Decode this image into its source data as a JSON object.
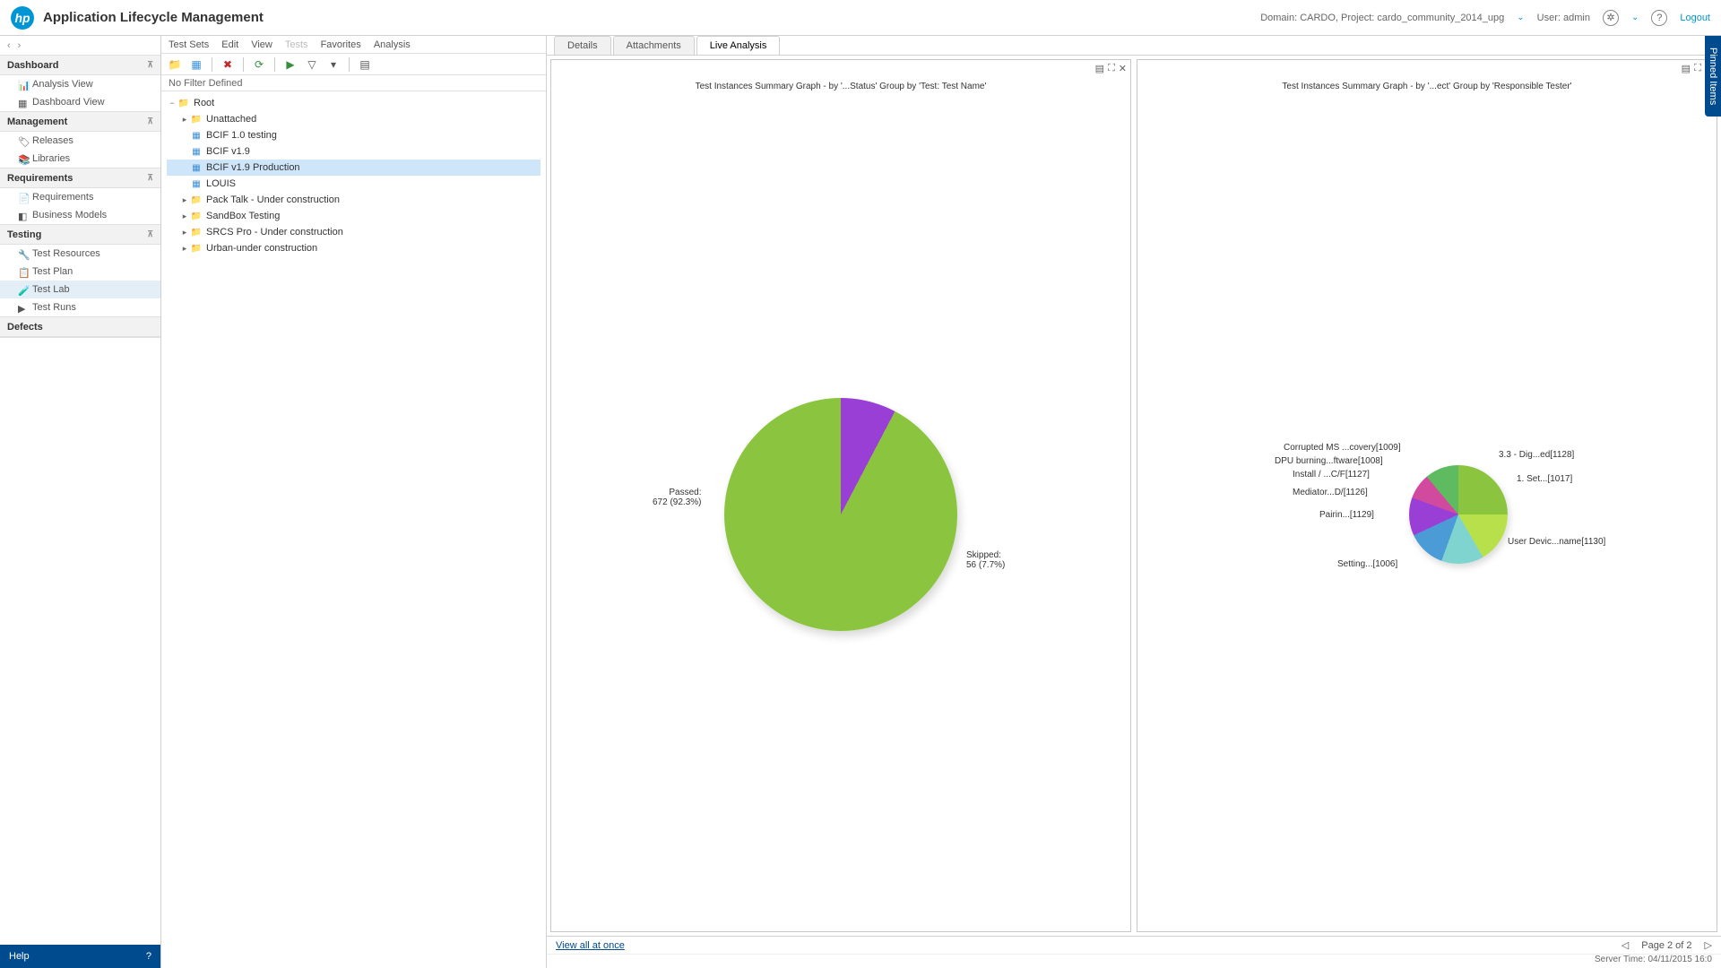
{
  "header": {
    "app_title": "Application Lifecycle Management",
    "domain_project": "Domain: CARDO, Project: cardo_community_2014_upg",
    "user": "User: admin",
    "logout": "Logout"
  },
  "sidebar": {
    "sections": [
      {
        "title": "Dashboard",
        "items": [
          "Analysis View",
          "Dashboard View"
        ]
      },
      {
        "title": "Management",
        "items": [
          "Releases",
          "Libraries"
        ]
      },
      {
        "title": "Requirements",
        "items": [
          "Requirements",
          "Business Models"
        ]
      },
      {
        "title": "Testing",
        "items": [
          "Test Resources",
          "Test Plan",
          "Test Lab",
          "Test Runs"
        ],
        "selected": 2
      },
      {
        "title": "Defects",
        "items": []
      }
    ],
    "help": "Help"
  },
  "menubar": [
    "Test Sets",
    "Edit",
    "View",
    "Tests",
    "Favorites",
    "Analysis"
  ],
  "filter_text": "No Filter Defined",
  "tree": {
    "root": "Root",
    "nodes": [
      {
        "label": "Unattached",
        "type": "folder"
      },
      {
        "label": "BCIF 1.0 testing",
        "type": "file"
      },
      {
        "label": "BCIF v1.9",
        "type": "file"
      },
      {
        "label": "BCIF v1.9 Production",
        "type": "file",
        "selected": true
      },
      {
        "label": "LOUIS",
        "type": "file"
      },
      {
        "label": "Pack Talk - Under construction",
        "type": "folder"
      },
      {
        "label": "SandBox Testing",
        "type": "folder"
      },
      {
        "label": "SRCS Pro - Under construction",
        "type": "folder"
      },
      {
        "label": "Urban-under construction",
        "type": "folder"
      }
    ]
  },
  "tabs": [
    "Details",
    "Attachments",
    "Live Analysis"
  ],
  "active_tab": 2,
  "pinned_label": "Pinned Items",
  "chart_data": [
    {
      "type": "pie",
      "title": "Test Instances Summary Graph - by '...Status' Group by 'Test: Test Name'",
      "series": [
        {
          "name": "Passed",
          "value": 672,
          "pct": 92.3,
          "color": "#8bc53f"
        },
        {
          "name": "Skipped",
          "value": 56,
          "pct": 7.7,
          "color": "#9a3fd6"
        }
      ],
      "labels": {
        "passed": "Passed:\n672 (92.3%)",
        "skipped": "Skipped:\n56 (7.7%)"
      }
    },
    {
      "type": "pie",
      "title": "Test Instances Summary Graph - by '...ect' Group by 'Responsible Tester'",
      "slices": [
        "Corrupted MS ...covery[1009]",
        "DPU burning...ftware[1008]",
        "Install / ...C/F[1127]",
        "Mediator...D/[1126]",
        "Pairin...[1129]",
        "Setting...[1006]",
        "User Devic...name[1130]",
        "1. Set...[1017]",
        "3.3 - Dig...ed[1128]"
      ]
    }
  ],
  "footer": {
    "view_all": "View all at once",
    "page": "Page 2 of 2",
    "server_time": "Server Time: 04/11/2015 16:0"
  }
}
